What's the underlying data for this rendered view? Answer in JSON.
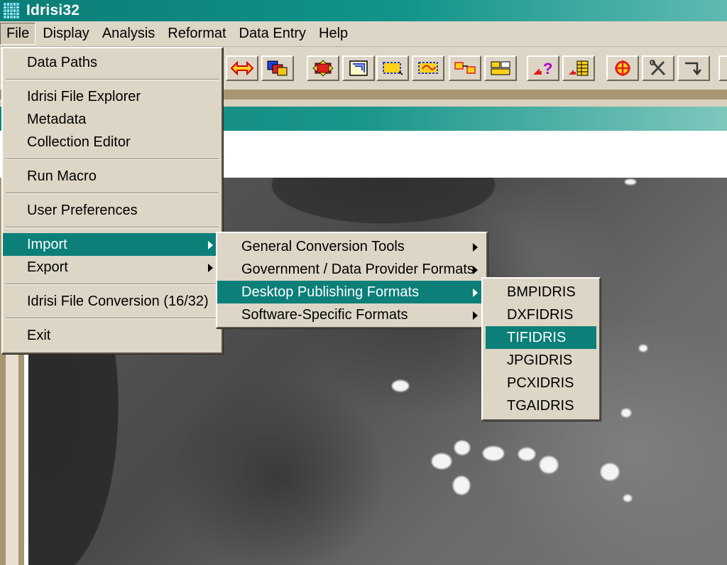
{
  "window": {
    "title": "Idrisi32"
  },
  "menubar": {
    "items": [
      "File",
      "Display",
      "Analysis",
      "Reformat",
      "Data Entry",
      "Help"
    ]
  },
  "toolbar": {
    "buttons": [
      "double-arrow-icon",
      "overlay-layers-icon",
      "move-icon",
      "layout-icon",
      "select-box-icon",
      "region-select-icon",
      "link-shapes-icon",
      "two-boxes-icon",
      "query-icon",
      "table-query-icon",
      "target-icon",
      "tools-icon",
      "return-arrow-icon"
    ]
  },
  "file_menu": {
    "groups": [
      [
        "Data Paths"
      ],
      [
        "Idrisi File Explorer",
        "Metadata",
        "Collection Editor"
      ],
      [
        "Run Macro"
      ],
      [
        "User Preferences"
      ],
      [
        "Import",
        "Export"
      ],
      [
        "Idrisi File Conversion (16/32)"
      ],
      [
        "Exit"
      ]
    ],
    "highlighted": "Import"
  },
  "import_menu": {
    "items": [
      "General Conversion Tools",
      "Government / Data Provider Formats",
      "Desktop Publishing Formats",
      "Software-Specific Formats"
    ],
    "highlighted": "Desktop Publishing Formats"
  },
  "dtp_menu": {
    "items": [
      "BMPIDRIS",
      "DXFIDRIS",
      "TIFIDRIS",
      "JPGIDRIS",
      "PCXIDRIS",
      "TGAIDRIS"
    ],
    "highlighted": "TIFIDRIS"
  },
  "colors": {
    "accent": "#0c7f79",
    "menu_bg": "#ddd6c6",
    "frame_brown": "#a89572"
  }
}
